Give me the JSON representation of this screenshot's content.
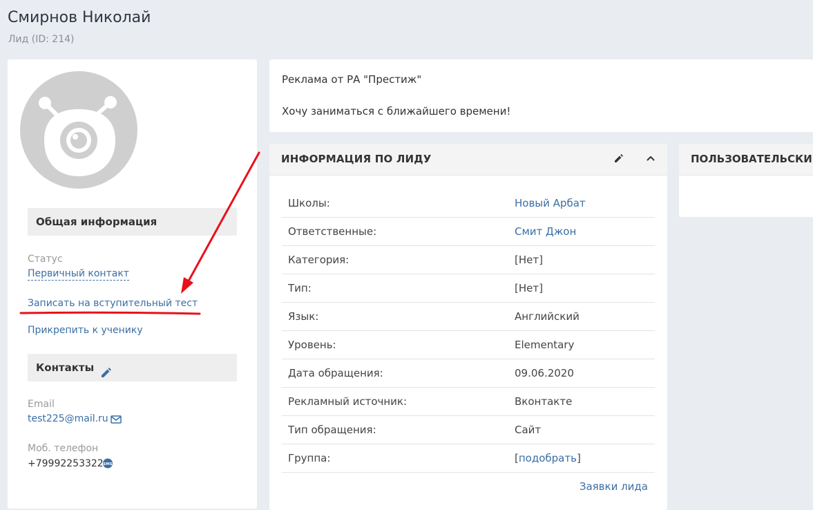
{
  "header": {
    "name": "Смирнов Николай",
    "subtitle": "Лид (ID: 214)"
  },
  "sidebar": {
    "general_section": "Общая информация",
    "status_label": "Статус",
    "status_value": "Первичный контакт",
    "action_test": "Записать на вступительный тест",
    "action_attach": "Прикрепить к ученику",
    "contacts_section": "Контакты",
    "email_label": "Email",
    "email_value": "test225@mail.ru",
    "phone_label": "Моб. телефон",
    "phone_value": "+79992253322",
    "sms_badge": "SMS"
  },
  "note": {
    "line1": "Реклама от РА \"Престиж\"",
    "line2": "Хочу заниматься с ближайшего времени!"
  },
  "lead_info": {
    "title": "ИНФОРМАЦИЯ ПО ЛИДУ",
    "rows": [
      {
        "label": "Школы:",
        "value": "Новый Арбат"
      },
      {
        "label": "Ответственные:",
        "value": "Смит Джон"
      },
      {
        "label": "Категория:",
        "value": "[Нет]"
      },
      {
        "label": "Тип:",
        "value": "[Нет]"
      },
      {
        "label": "Язык:",
        "value": "Английский"
      },
      {
        "label": "Уровень:",
        "value": "Elementary"
      },
      {
        "label": "Дата обращения:",
        "value": "09.06.2020"
      },
      {
        "label": "Рекламный источник:",
        "value": "Вконтакте"
      },
      {
        "label": "Тип обращения:",
        "value": "Сайт"
      },
      {
        "label": "Группа:",
        "value_prefix": "[",
        "value_link": "подобрать",
        "value_suffix": "]"
      }
    ],
    "footer_link": "Заявки лида"
  },
  "user_fields": {
    "title": "ПОЛЬЗОВАТЕЛЬСКИЕ"
  },
  "colors": {
    "link": "#3a6ea5",
    "annotation": "#e8101a",
    "background": "#e9ecf1"
  },
  "icons": [
    "avatar-placeholder",
    "pencil-icon",
    "chevron-up-icon",
    "envelope-icon",
    "sms-icon"
  ]
}
